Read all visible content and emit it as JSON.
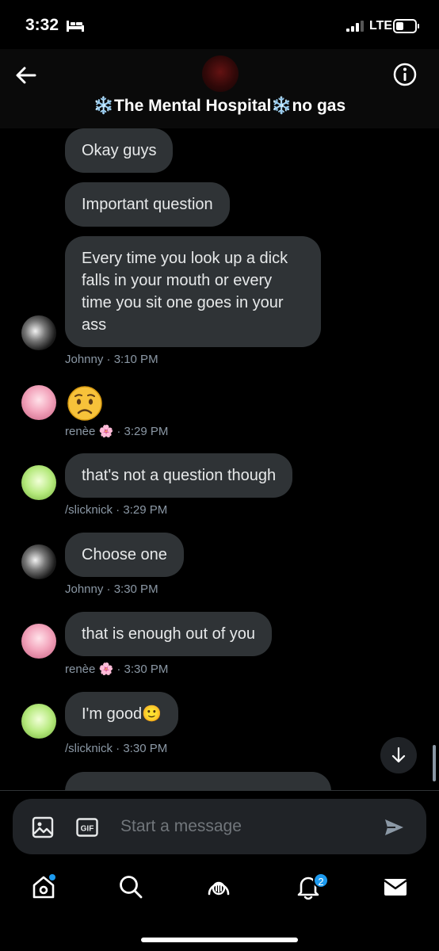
{
  "status_bar": {
    "time": "3:32",
    "network": "LTE"
  },
  "header": {
    "title": "❄️The Mental Hospital❄️no gas"
  },
  "messages": [
    {
      "text": "Okay guys"
    },
    {
      "text": "Important question"
    },
    {
      "text": "Every time you look up a dick falls in your mouth or every time you sit one goes in your ass",
      "meta": "Johnny · 3:10 PM"
    },
    {
      "emoji": "😟",
      "meta": "renèe 🌸 · 3:29 PM"
    },
    {
      "text": "that's not a question though",
      "meta": "/slicknick · 3:29 PM"
    },
    {
      "text": "Choose one",
      "meta": "Johnny · 3:30 PM"
    },
    {
      "text": "that is enough out of you",
      "meta": "renèe 🌸 · 3:30 PM"
    },
    {
      "text": "I'm good🙂",
      "meta": "/slicknick · 3:30 PM"
    }
  ],
  "composer": {
    "placeholder": "Start a message"
  },
  "tabbar": {
    "notifications_badge": "2"
  },
  "colors": {
    "accent": "#1d9bf0",
    "bubble": "#2f3336",
    "meta": "#8b98a5",
    "background": "#000000"
  }
}
